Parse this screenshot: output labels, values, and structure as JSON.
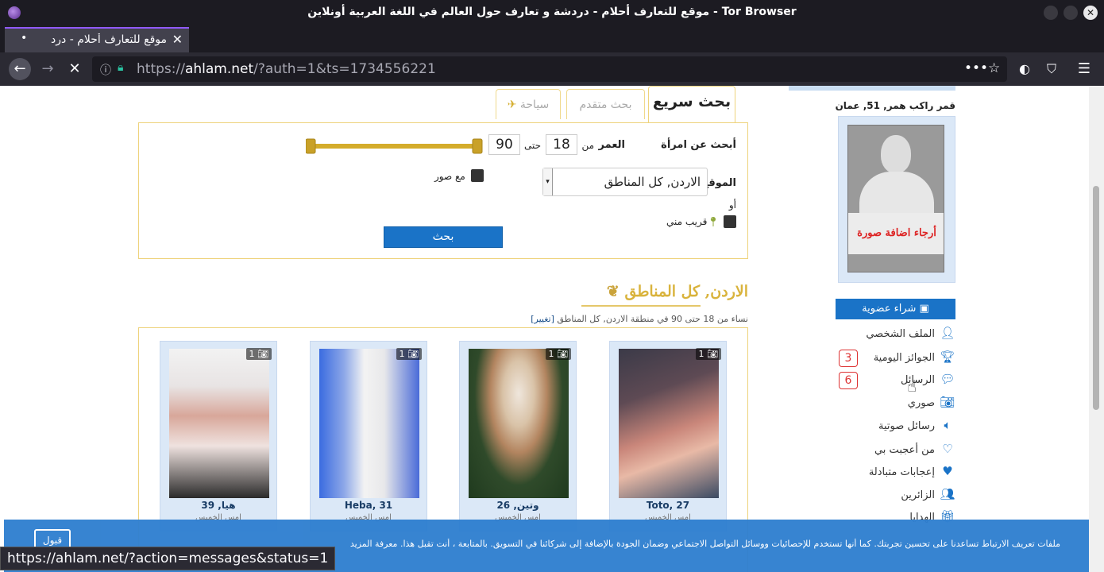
{
  "window": {
    "title": "موقع للتعارف أحلام - دردشة و تعارف حول العالم في اللغة العربية أونلاين - Tor Browser"
  },
  "tab": {
    "title": "موقع للتعارف أحلام - درد",
    "close": "✕",
    "new_tab": "+"
  },
  "navbar": {
    "url_prefix": "https://",
    "url_host": "ahlam.net",
    "url_rest": "/?auth=1&ts=1734556221",
    "more": "•••",
    "bookmark": "☆"
  },
  "sidebar": {
    "profile_name": "قمر راكب همر, 51, عمان",
    "add_photo_text": "أرجاء اضافة صورة",
    "buy_membership": "شراء عضوية",
    "menu": [
      {
        "label": "الملف الشخصي",
        "icon": "user-icon"
      },
      {
        "label": "الجوائز اليومية",
        "icon": "trophy-icon",
        "badge": "3"
      },
      {
        "label": "الرسائل",
        "icon": "chat-icon",
        "badge": "6"
      },
      {
        "label": "صوري",
        "icon": "camera-icon"
      },
      {
        "label": "رسائل صوتية",
        "icon": "speaker-icon"
      },
      {
        "label": "من أعجبت بي",
        "icon": "heart-icon"
      },
      {
        "label": "إعجابات متبادلة",
        "icon": "hearts-icon"
      },
      {
        "label": "الزائرين",
        "icon": "users-icon"
      },
      {
        "label": "الهدايا",
        "icon": "gift-icon"
      }
    ]
  },
  "search": {
    "tabs": {
      "quick": "بحث سريع",
      "advanced": "بحث متقدم",
      "tourism": "سياحة"
    },
    "looking_for": "أبحث عن امرأة",
    "age_label": "العمر",
    "from_label": "من",
    "age_from": "18",
    "to_label": "حتى",
    "age_to": "90",
    "age_range": {
      "min": 18,
      "max": 90,
      "low": 18,
      "high": 90
    },
    "location_label": "الموقع",
    "location_value": "الاردن, كل المناطق",
    "with_photos": "مع صور",
    "or_label": "أو",
    "near_me": "قريب مني",
    "submit": "بحث"
  },
  "results": {
    "title": "الاردن, كل المناطق",
    "subtitle": "نساء من 18 حتى 90 في منطقة الاردن, كل المناطق",
    "change_link": "[تغيير]",
    "cards": [
      {
        "name": "Toto, 27",
        "photos": "1",
        "sub": "امس الخميس"
      },
      {
        "name": "وتين, 26",
        "photos": "1",
        "sub": "امس الخميس"
      },
      {
        "name": "Heba, 31",
        "photos": "1",
        "sub": "امس الخميس"
      },
      {
        "name": "هيا, 39",
        "photos": "1",
        "sub": "امس الخميس"
      }
    ]
  },
  "cookie": {
    "text": "ملفات تعريف الارتباط تساعدنا على تحسين تجربتك. كما أنها تستخدم للإحصائيات ووسائل التواصل الاجتماعي وضمان الجودة بالإضافة إلى شركائنا في التسويق. بالمتابعة ، أنت تقبل هذا. معرفة المزيد",
    "accept": "قبول"
  },
  "status_url": "https://ahlam.net/?action=messages&status=1",
  "colors": {
    "accent_blue": "#1a73c7",
    "gold": "#d4ac2b",
    "browser_dark": "#1c1b22"
  }
}
